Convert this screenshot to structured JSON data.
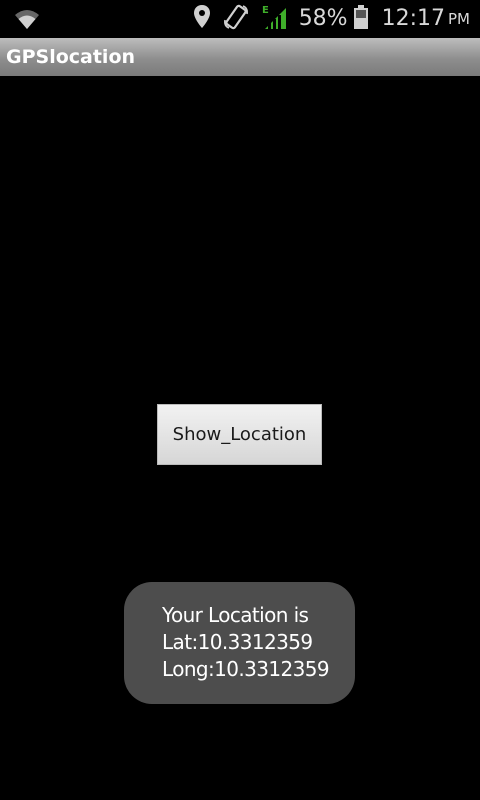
{
  "status_bar": {
    "icons": [
      "wifi-icon",
      "location-pin-icon",
      "screen-rotate-icon",
      "signal-e-icon",
      "battery-icon"
    ],
    "network_type": "E",
    "battery_percent": "58%",
    "time": "12:17",
    "ampm": "PM",
    "colors": {
      "signal": "#3fae2a",
      "icon": "#d0d0d0"
    }
  },
  "app": {
    "title": "GPSlocation"
  },
  "main": {
    "button_label": "Show_Location"
  },
  "toast": {
    "line1": "Your Location is",
    "line2": "Lat:10.3312359",
    "line3": "Long:10.3312359"
  }
}
